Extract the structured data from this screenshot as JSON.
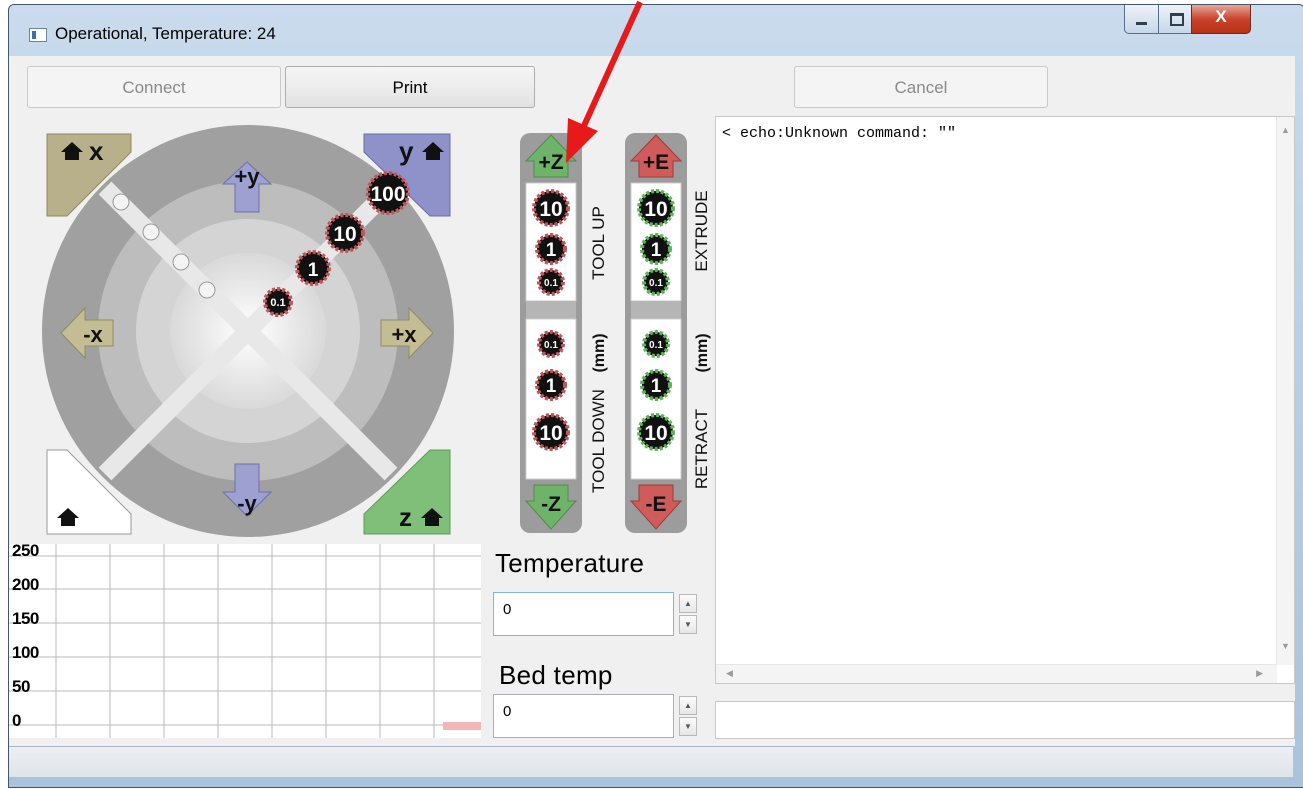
{
  "window": {
    "title": "Operational, Temperature: 24",
    "close_glyph": "X"
  },
  "toolbar": {
    "connect_label": "Connect",
    "print_label": "Print",
    "cancel_label": "Cancel"
  },
  "xy_pad": {
    "home_x_label": "x",
    "home_y_label": "y",
    "home_z_label": "z",
    "plus_y": "+y",
    "minus_y": "-y",
    "plus_x": "+x",
    "minus_x": "-x",
    "step_100": "100",
    "step_10": "10",
    "step_1": "1",
    "step_01": "0.1"
  },
  "z_column": {
    "up_label": "+Z",
    "down_label": "-Z",
    "steps": [
      "10",
      "1",
      "0.1"
    ],
    "side_up": "TOOL UP",
    "side_mm": "(mm)",
    "side_down": "TOOL DOWN"
  },
  "e_column": {
    "up_label": "+E",
    "down_label": "-E",
    "steps": [
      "10",
      "1",
      "0.1"
    ],
    "side_up": "EXTRUDE",
    "side_mm": "(mm)",
    "side_down": "RETRACT"
  },
  "graph": {
    "y_ticks": [
      "250",
      "200",
      "150",
      "100",
      "50",
      "0"
    ]
  },
  "temperature": {
    "label": "Temperature",
    "value": "0"
  },
  "bed": {
    "label": "Bed temp",
    "value": "0"
  },
  "log": {
    "lines": [
      "< echo:Unknown command: \"\""
    ]
  },
  "colors": {
    "red_arrow": "#e8191a",
    "z_green": "#6fb26a",
    "e_red": "#cf5b5b",
    "home_olive": "#b7b08a",
    "home_blue": "#8f92c8"
  }
}
